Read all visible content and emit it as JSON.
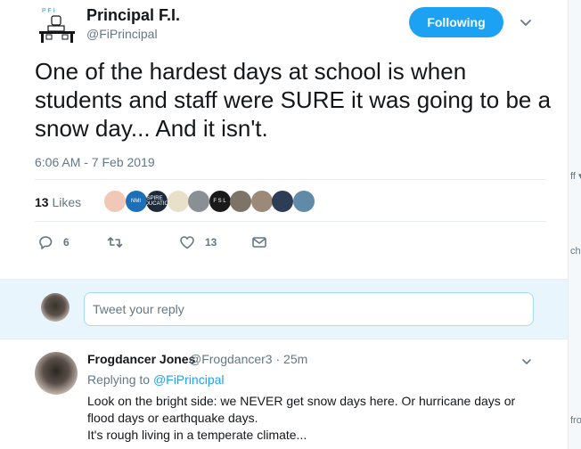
{
  "colors": {
    "accent": "#1da1f2",
    "muted": "#657786",
    "text": "#14171a",
    "reply_bg": "#e8f5fd"
  },
  "tweet": {
    "display_name": "Principal F.I.",
    "handle": "@FiPrincipal",
    "logo_text": "P F I",
    "follow_label": "Following",
    "text": "One of the hardest days at school is when students and staff were SURE it was going to be a snow day... And it isn't.",
    "timestamp": "6:06 AM - 7 Feb 2019",
    "likes_count": "13",
    "likes_label": "Likes",
    "actions": {
      "reply_count": "6",
      "retweet_count": "",
      "like_count": "13"
    },
    "likers": [
      {
        "name": "liker-1",
        "color": "#f1c7b5"
      },
      {
        "name": "liker-2",
        "color": "#1d6fb8",
        "text": "NMI"
      },
      {
        "name": "liker-3",
        "color": "#1c2a3a",
        "text": "INSPIRE EDUCATION"
      },
      {
        "name": "liker-4",
        "color": "#e8e0c8"
      },
      {
        "name": "liker-5",
        "color": "#8a8f96"
      },
      {
        "name": "liker-6",
        "color": "#1a1a1a",
        "text": "F S L"
      },
      {
        "name": "liker-7",
        "color": "#7d7468"
      },
      {
        "name": "liker-8",
        "color": "#9c8a78"
      },
      {
        "name": "liker-9",
        "color": "#2d3d55"
      },
      {
        "name": "liker-10",
        "color": "#5f8aa8"
      }
    ]
  },
  "reply_box": {
    "placeholder": "Tweet your reply"
  },
  "reply_tweet": {
    "name": "Frogdancer Jones",
    "handle": "@Frogdancer3 · 25m",
    "replying_prefix": "Replying to",
    "replying_to": "@FiPrincipal",
    "text_lines": [
      "Look on the bright side: we NEVER get snow days here. Or hurricane days or",
      "flood days or earthquake days.",
      "It's rough living in a temperate climate..."
    ]
  },
  "side_strip": {
    "fragments": [
      "ff ▾",
      "ch",
      "fro"
    ]
  }
}
